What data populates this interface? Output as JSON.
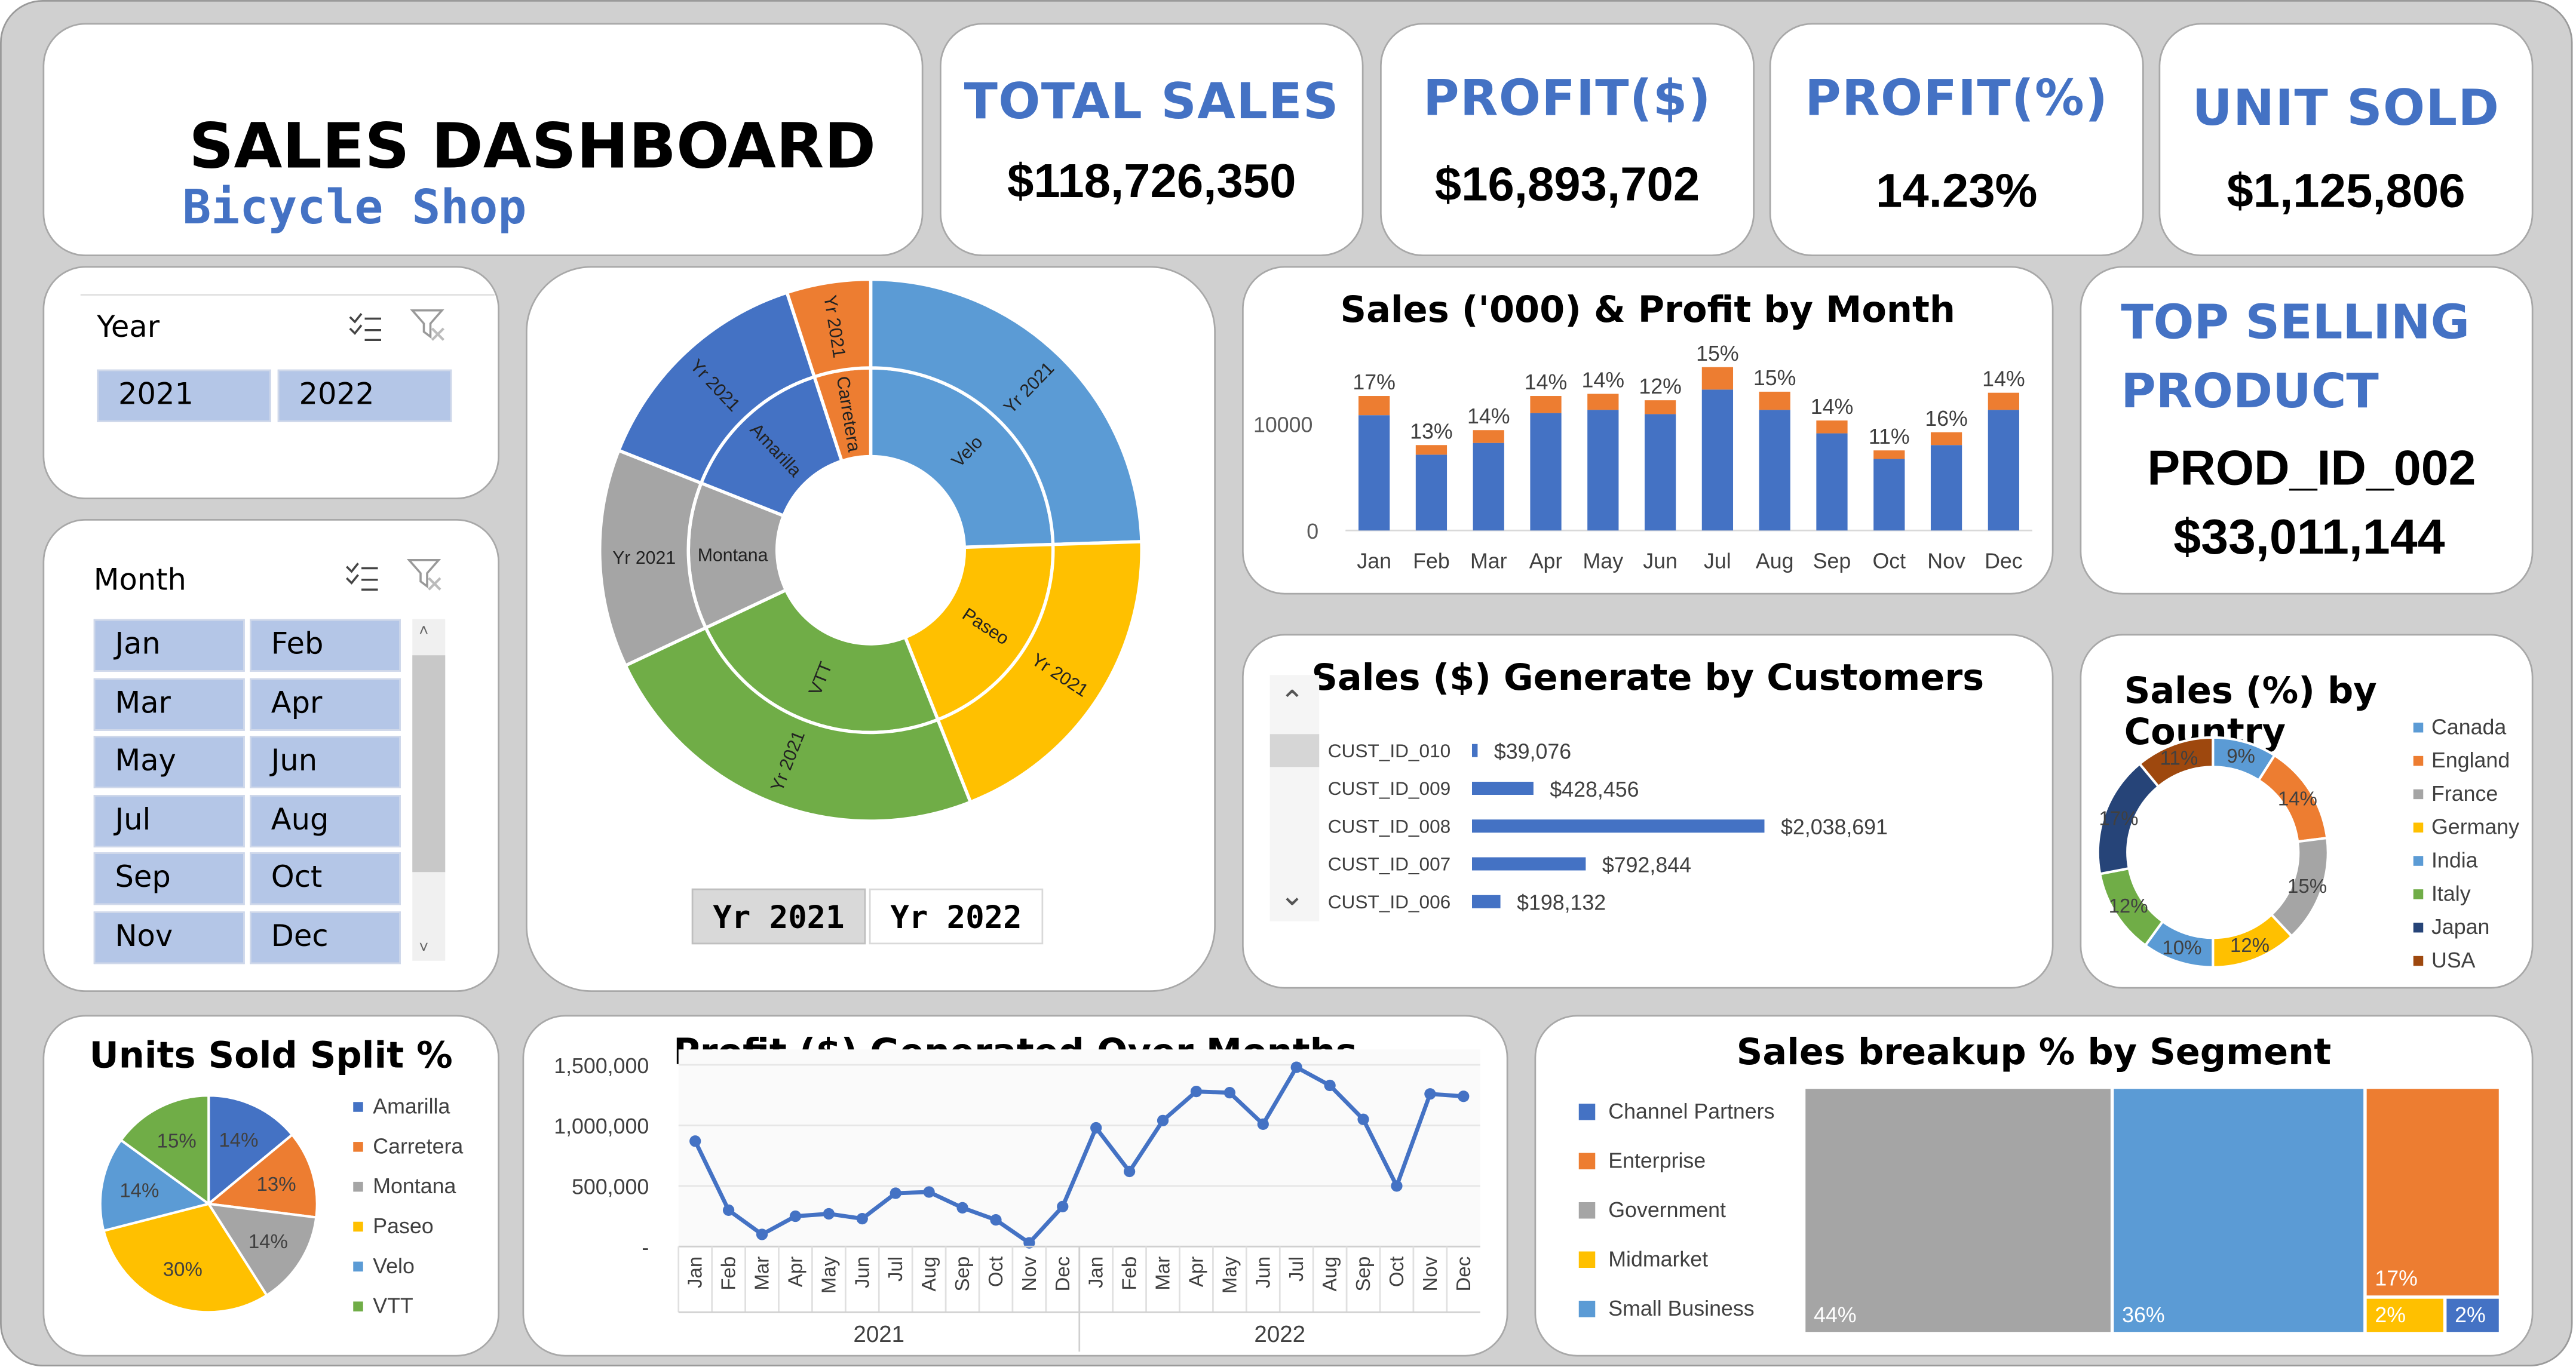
{
  "header": {
    "title": "SALES DASHBOARD",
    "subtitle": "Bicycle Shop"
  },
  "kpis": {
    "total_sales": {
      "label": "TOTAL SALES",
      "value": "$118,726,350"
    },
    "profit_dollar": {
      "label": "PROFIT($)",
      "value": "$16,893,702"
    },
    "profit_pct": {
      "label": "PROFIT(%)",
      "value": "14.23%"
    },
    "units": {
      "label": "UNIT SOLD",
      "value": "$1,125,806"
    }
  },
  "top_product": {
    "label_line1": "TOP SELLING",
    "label_line2": "PRODUCT",
    "product": "PROD_ID_002",
    "value": "$33,011,144"
  },
  "year_slicer": {
    "title": "Year",
    "items": [
      "2021",
      "2022"
    ]
  },
  "month_slicer": {
    "title": "Month",
    "items": [
      "Jan",
      "Feb",
      "Mar",
      "Apr",
      "May",
      "Jun",
      "Jul",
      "Aug",
      "Sep",
      "Oct",
      "Nov",
      "Dec"
    ]
  },
  "sunburst_tabs": [
    "Yr 2021",
    "Yr 2022"
  ],
  "colors": {
    "blue": "#4472c4",
    "orange": "#ed7d31",
    "gray": "#a5a5a5",
    "yellow": "#ffc000",
    "lightblue": "#5b9bd5",
    "green": "#70ad47",
    "navy": "#264478",
    "brown": "#9e480e"
  },
  "chart_data": [
    {
      "id": "sunburst",
      "type": "sunburst",
      "inner": [
        {
          "name": "Velo",
          "value": 24.5,
          "color": "#5b9bd5"
        },
        {
          "name": "Paseo",
          "value": 19.5,
          "color": "#ffc000"
        },
        {
          "name": "VTT",
          "value": 24,
          "color": "#70ad47"
        },
        {
          "name": "Montana",
          "value": 13,
          "color": "#a5a5a5"
        },
        {
          "name": "Amarilla",
          "value": 14,
          "color": "#4472c4"
        },
        {
          "name": "Carretera",
          "value": 5,
          "color": "#ed7d31"
        }
      ],
      "outer_label": "Yr 2021"
    },
    {
      "id": "monthly",
      "type": "bar",
      "title": "Sales ('000) & Profit by Month",
      "categories": [
        "Jan",
        "Feb",
        "Mar",
        "Apr",
        "May",
        "Jun",
        "Jul",
        "Aug",
        "Sep",
        "Oct",
        "Nov",
        "Dec"
      ],
      "series": [
        {
          "values": [
            10800,
            7100,
            8200,
            11000,
            11300,
            10900,
            13200,
            11300,
            9100,
            6700,
            8000,
            11300
          ]
        },
        {
          "values": [
            1800,
            900,
            1200,
            1600,
            1500,
            1300,
            2100,
            1700,
            1200,
            800,
            1200,
            1600
          ]
        }
      ],
      "data_labels": [
        "17%",
        "13%",
        "14%",
        "14%",
        "14%",
        "12%",
        "15%",
        "15%",
        "14%",
        "11%",
        "16%",
        "14%"
      ],
      "y_ticks": [
        "0",
        "10000"
      ],
      "ylim": [
        0,
        16000
      ]
    },
    {
      "id": "customers",
      "type": "bar",
      "orientation": "horizontal",
      "title": "Sales ($) Generate by Customers",
      "categories": [
        "CUST_ID_010",
        "CUST_ID_009",
        "CUST_ID_008",
        "CUST_ID_007",
        "CUST_ID_006"
      ],
      "values": [
        39076,
        428456,
        2038691,
        792844,
        198132
      ],
      "labels": [
        "$39,076",
        "$428,456",
        "$2,038,691",
        "$792,844",
        "$198,132"
      ]
    },
    {
      "id": "country",
      "type": "pie",
      "title": "Sales (%) by Country",
      "categories": [
        "Canada",
        "England",
        "France",
        "Germany",
        "India",
        "Italy",
        "Japan",
        "USA"
      ],
      "values": [
        9,
        14,
        15,
        12,
        10,
        12,
        17,
        11
      ],
      "labels": [
        "9%",
        "14%",
        "15%",
        "12%",
        "10%",
        "12%",
        "17%",
        "11%"
      ]
    },
    {
      "id": "units",
      "type": "pie",
      "title": "Units Sold Split %",
      "categories": [
        "Amarilla",
        "Carretera",
        "Montana",
        "Paseo",
        "Velo",
        "VTT"
      ],
      "values": [
        14,
        13,
        14,
        30,
        14,
        15
      ],
      "labels": [
        "14%",
        "13%",
        "14%",
        "30%",
        "14%",
        "15%"
      ]
    },
    {
      "id": "profit_line",
      "type": "line",
      "title": "Profit ($) Generated Over Months",
      "x": [
        "Jan",
        "Feb",
        "Mar",
        "Apr",
        "May",
        "Jun",
        "Jul",
        "Aug",
        "Sep",
        "Oct",
        "Nov",
        "Dec",
        "Jan",
        "Feb",
        "Mar",
        "Apr",
        "May",
        "Jun",
        "Jul",
        "Aug",
        "Sep",
        "Oct",
        "Nov",
        "Dec"
      ],
      "groups": [
        "2021",
        "2022"
      ],
      "values": [
        870000,
        300000,
        100000,
        250000,
        270000,
        230000,
        440000,
        450000,
        320000,
        220000,
        30000,
        330000,
        980000,
        620000,
        1040000,
        1280000,
        1270000,
        1010000,
        1480000,
        1330000,
        1050000,
        500000,
        1260000,
        1240000
      ],
      "y_ticks": [
        "-",
        "500,000",
        "1,000,000",
        "1,500,000"
      ],
      "ylim": [
        0,
        1600000
      ]
    },
    {
      "id": "segment",
      "type": "treemap",
      "title": "Sales breakup % by Segment",
      "categories": [
        "Channel Partners",
        "Enterprise",
        "Government",
        "Midmarket",
        "Small Business"
      ],
      "values": [
        2,
        17,
        44,
        2,
        36
      ],
      "labels": [
        "2%",
        "17%",
        "44%",
        "2%",
        "36%"
      ]
    }
  ]
}
